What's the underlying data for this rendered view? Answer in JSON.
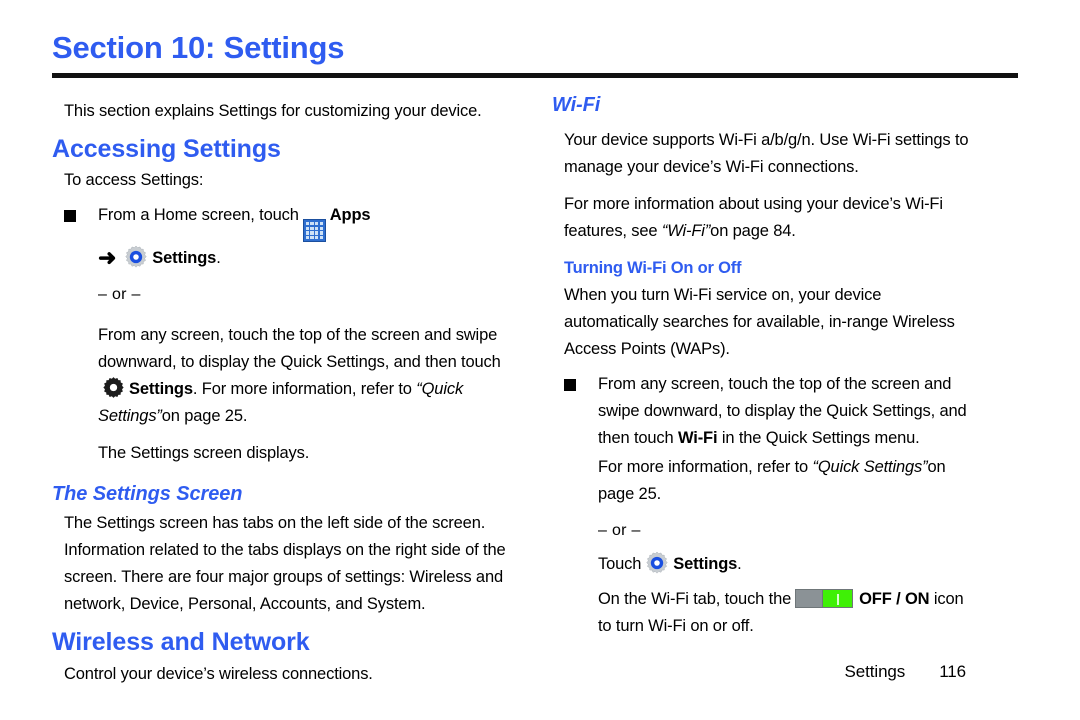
{
  "document": {
    "section_title": "Section 10: Settings",
    "intro": "This section explains Settings for customizing your device."
  },
  "left_column": {
    "accessing_settings": {
      "heading": "Accessing Settings",
      "lead": "To access Settings:",
      "bullet": {
        "line1_a": "From a Home screen, touch",
        "apps_label": "Apps",
        "arrow": "➜",
        "settings_label": "Settings",
        "period": ".",
        "or_divider": "– or –",
        "para2_a": "From any screen, touch the top of the screen and swipe downward, to display the Quick Settings, and then touch",
        "para2_settings": "Settings",
        "para2_b": ". For more information, refer to",
        "para2_ref": "“Quick Settings”",
        "para2_c": "on page 25.",
        "para3": "The Settings screen displays."
      }
    },
    "settings_screen": {
      "heading": "The Settings Screen",
      "body": "The Settings screen has tabs on the left side of the screen. Information related to the tabs displays on the right side of the screen. There are four major groups of settings: Wireless and network, Device, Personal, Accounts, and System."
    },
    "wireless_network": {
      "heading": "Wireless and Network",
      "body": "Control your device’s wireless connections."
    }
  },
  "right_column": {
    "wifi": {
      "heading": "Wi-Fi",
      "para1": "Your device supports Wi-Fi a/b/g/n. Use Wi-Fi settings to manage your device’s Wi-Fi connections.",
      "para2_a": "For more information about using your device’s Wi-Fi features, see",
      "para2_ref": "“Wi-Fi”",
      "para2_b": "on page 84."
    },
    "turning_wifi": {
      "heading": "Turning Wi-Fi On or Off",
      "intro": "When you turn Wi-Fi service on, your device automatically searches for available, in-range Wireless Access Points (WAPs).",
      "bullet": {
        "line_a": "From any screen, touch the top of the screen and swipe downward, to display the Quick Settings, and then touch",
        "wifi_bold": "Wi-Fi",
        "line_b": "in the Quick Settings menu.",
        "ref_a": "For more information, refer to",
        "ref_quote": "“Quick Settings”",
        "ref_b": "on page 25.",
        "or_divider": "– or –",
        "touch_label": "Touch",
        "settings_label": "Settings",
        "period": ".",
        "toggle_a": "On the Wi-Fi tab, touch the",
        "toggle_label": "OFF / ON",
        "toggle_b": "icon to turn Wi-Fi on or off."
      }
    }
  },
  "footer": {
    "label": "Settings",
    "page_number": "116"
  },
  "colors": {
    "heading_blue": "#2f5cf0",
    "body_black": "#000000",
    "toggle_on_green": "#3ff006",
    "toggle_off_gray": "#8b9296",
    "apps_icon_blue": "#2f6fd0"
  }
}
